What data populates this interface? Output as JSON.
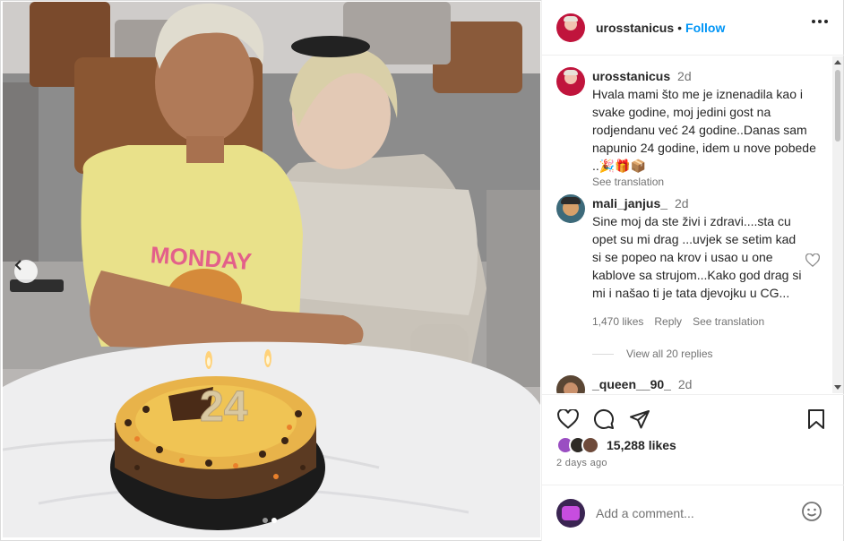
{
  "post": {
    "username": "urosstanicus",
    "follow_label": "Follow",
    "separator": "•"
  },
  "caption": {
    "username": "urosstanicus",
    "time": "2d",
    "text": "Hvala mami što me je iznenadila kao i svake godine, moj jedini gost na rodjendanu već 24 godine..Danas sam napunio 24 godine, idem u nove pobede ..🎉🎁📦",
    "see_translation": "See translation"
  },
  "comments": [
    {
      "username": "mali_janjus_",
      "time": "2d",
      "text": "Sine moj da ste živi i zdravi....sta cu opet su mi drag ...uvjek se setim kad si se popeo na krov i usao u one kablove sa strujom...Kako god drag si mi i našao ti je tata djevojku u CG...",
      "likes": "1,470 likes",
      "reply_label": "Reply",
      "see_translation": "See translation",
      "view_replies": "View all 20 replies"
    },
    {
      "username": "_queen__90_",
      "time": "2d"
    }
  ],
  "actions": {
    "like_icon": "heart-icon",
    "comment_icon": "comment-icon",
    "share_icon": "share-icon",
    "save_icon": "bookmark-icon"
  },
  "likes": {
    "count_text": "15,288 likes"
  },
  "posted_at": "2 days ago",
  "add_comment": {
    "placeholder": "Add a comment..."
  },
  "cake_topper": "24",
  "shirt_text": "MONDAY",
  "colors": {
    "link_blue": "#0095f6",
    "text": "#262626",
    "muted": "#737373",
    "border": "#efefef"
  }
}
